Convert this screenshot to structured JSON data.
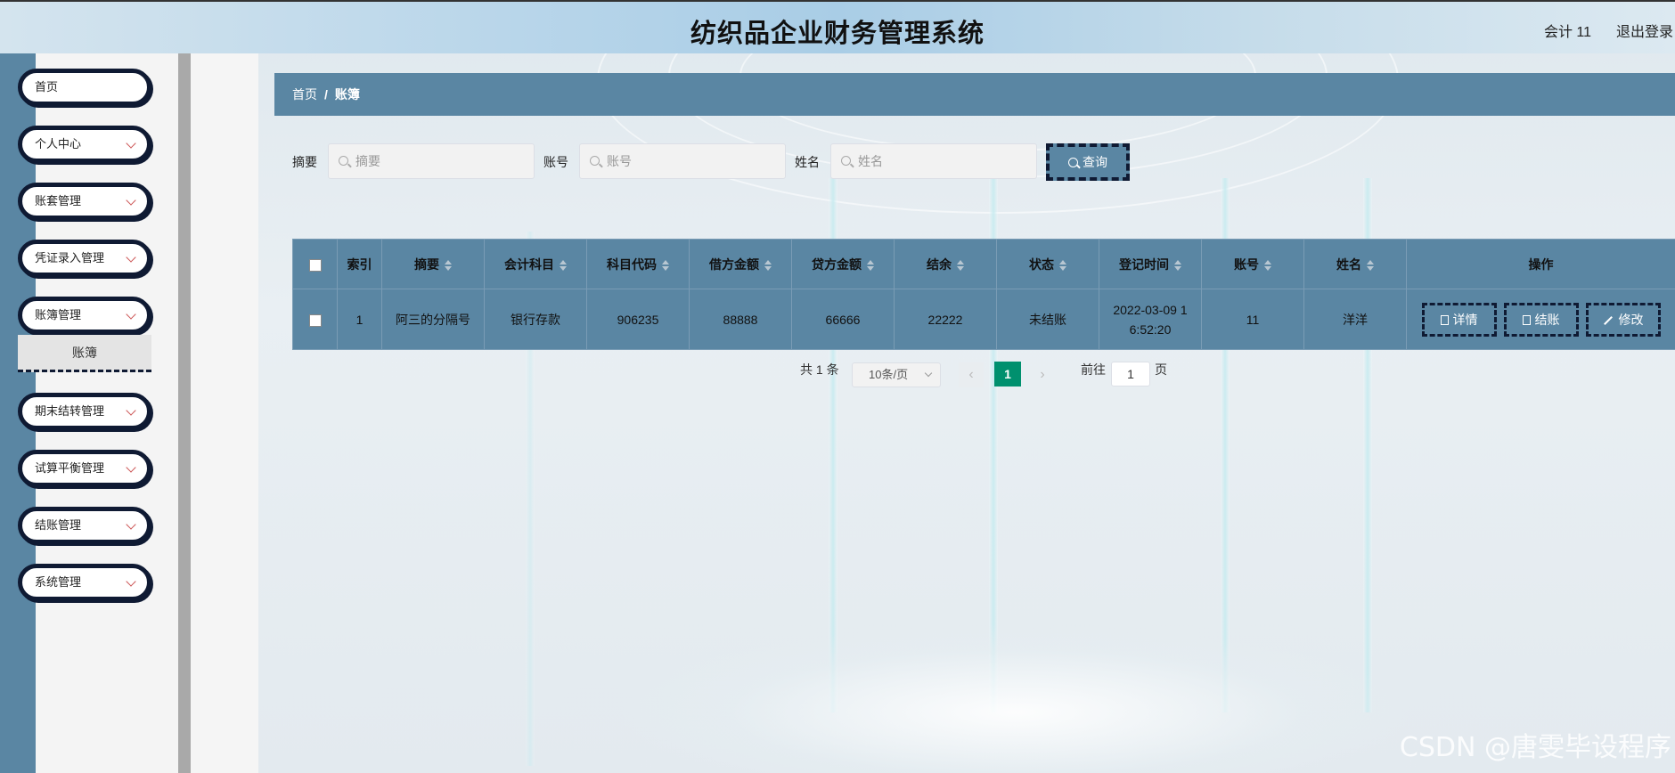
{
  "header": {
    "title": "纺织品企业财务管理系统",
    "user": "会计 11",
    "logout": "退出登录"
  },
  "sidebar": {
    "items": [
      {
        "label": "首页",
        "has_arrow": false
      },
      {
        "label": "个人中心",
        "has_arrow": true
      },
      {
        "label": "账套管理",
        "has_arrow": true
      },
      {
        "label": "凭证录入管理",
        "has_arrow": true
      },
      {
        "label": "账簿管理",
        "has_arrow": true
      },
      {
        "label": "期末结转管理",
        "has_arrow": true
      },
      {
        "label": "试算平衡管理",
        "has_arrow": true
      },
      {
        "label": "结账管理",
        "has_arrow": true
      },
      {
        "label": "系统管理",
        "has_arrow": true
      }
    ],
    "sub_item": "账簿"
  },
  "breadcrumb": {
    "home": "首页",
    "separator": "/",
    "current": "账簿"
  },
  "search": {
    "summary_label": "摘要",
    "summary_placeholder": "摘要",
    "account_label": "账号",
    "account_placeholder": "账号",
    "name_label": "姓名",
    "name_placeholder": "姓名",
    "button": "查询"
  },
  "table": {
    "columns": [
      "索引",
      "摘要",
      "会计科目",
      "科目代码",
      "借方金额",
      "贷方金额",
      "结余",
      "状态",
      "登记时间",
      "账号",
      "姓名",
      "操作"
    ],
    "rows": [
      {
        "index": "1",
        "summary": "阿三的分隔号",
        "subject": "银行存款",
        "code": "906235",
        "debit": "88888",
        "credit": "66666",
        "balance": "22222",
        "status": "未结账",
        "time_line1": "2022-03-09 1",
        "time_line2": "6:52:20",
        "account": "11",
        "name": "洋洋"
      }
    ],
    "actions": {
      "detail": "详情",
      "close": "结账",
      "edit": "修改"
    }
  },
  "pagination": {
    "total": "共 1 条",
    "page_size": "10条/页",
    "current_page": "1",
    "goto_label": "前往",
    "goto_value": "1",
    "page_unit": "页"
  },
  "watermark": "CSDN @唐雯毕设程序",
  "colors": {
    "primary": "#5a86a3",
    "dark_border": "#0f1a33",
    "active_page": "#00906e"
  }
}
